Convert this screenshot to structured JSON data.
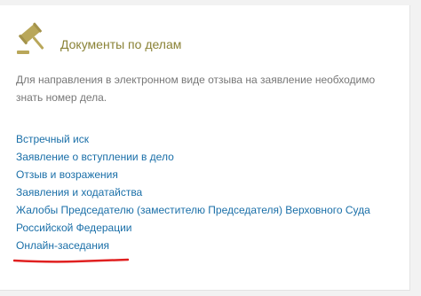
{
  "section": {
    "title": "Документы по делам",
    "icon": "gavel-icon",
    "description": "Для направления в электронном виде отзыва на заявление необходимо знать номер дела."
  },
  "links": [
    "Встречный иск",
    "Заявление о вступлении в дело",
    "Отзыв и возражения",
    "Заявления и ходатайства",
    "Жалобы Председателю (заместителю Председателя) Верховного Суда Российской Федерации",
    "Онлайн-заседания"
  ],
  "colors": {
    "title": "#8a8236",
    "link": "#1a6fa8",
    "text": "#777777",
    "highlight": "#e02020",
    "icon": "#b9a75a"
  }
}
